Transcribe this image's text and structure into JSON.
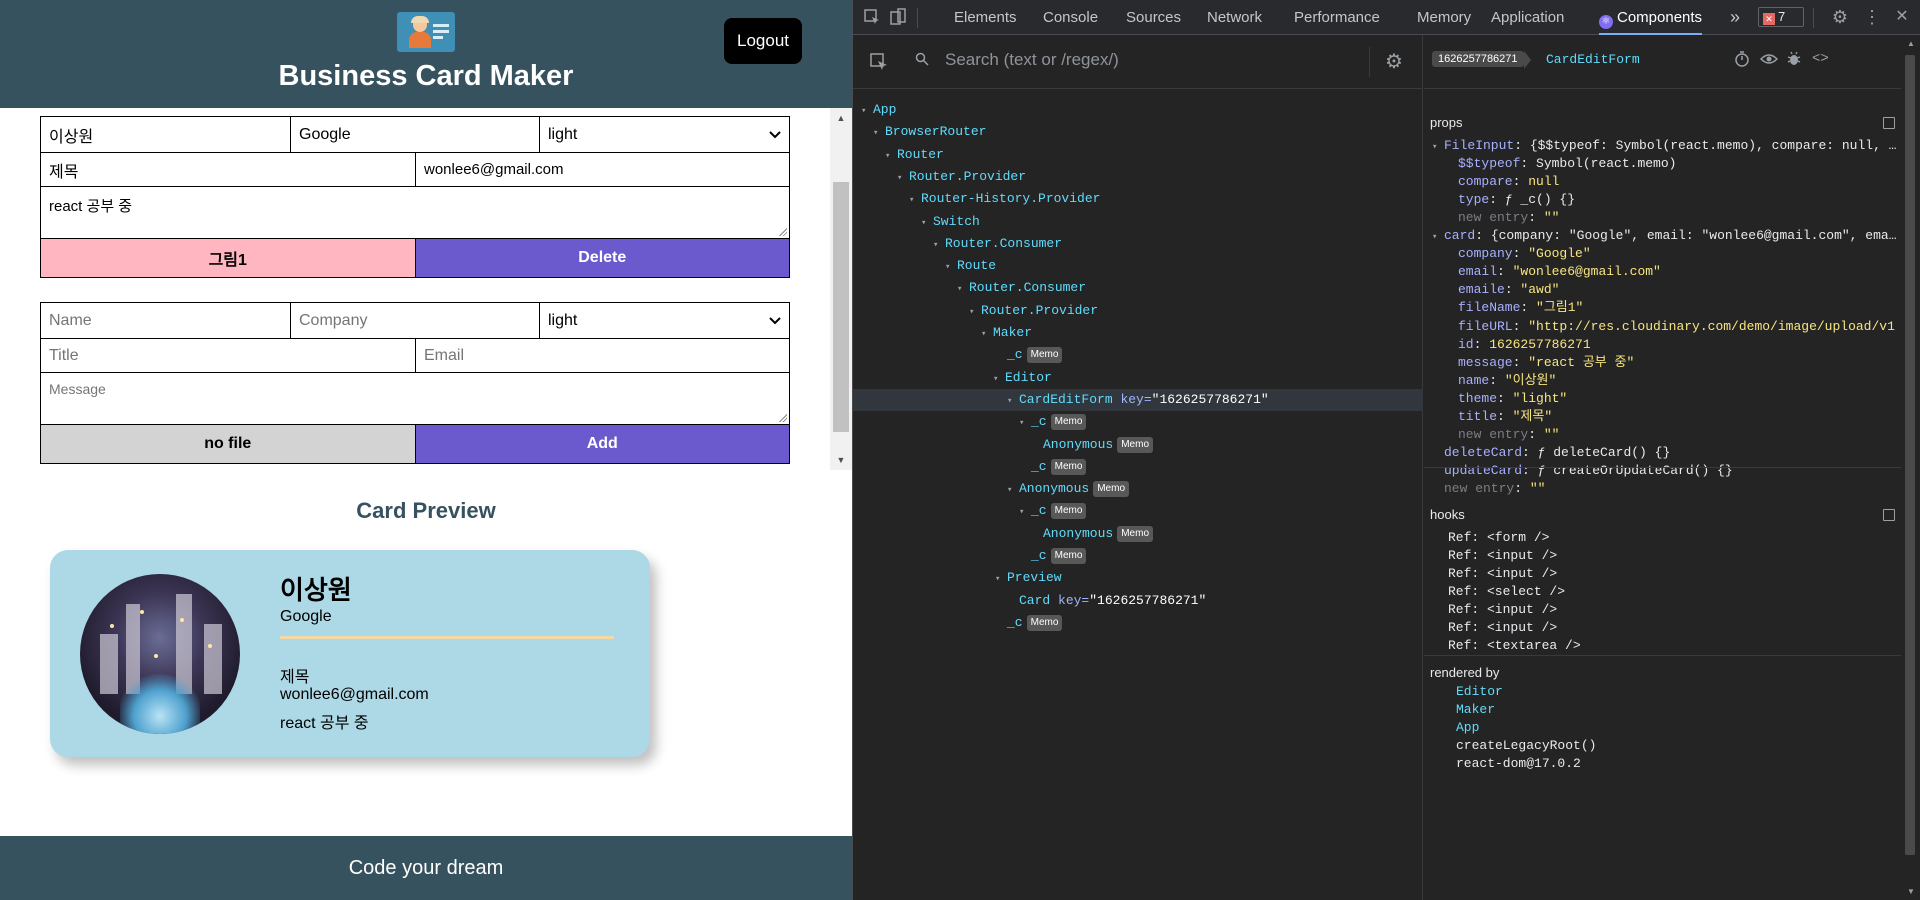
{
  "app": {
    "title": "Business Card Maker",
    "logout_label": "Logout",
    "footer": "Code your dream",
    "preview_title": "Card Preview"
  },
  "edit_form": {
    "name": "이상원",
    "company": "Google",
    "theme": "light",
    "title": "제목",
    "email": "wonlee6@gmail.com",
    "message": "react 공부 중",
    "file_button": "그림1",
    "delete_button": "Delete"
  },
  "add_form": {
    "name_placeholder": "Name",
    "company_placeholder": "Company",
    "theme": "light",
    "title_placeholder": "Title",
    "email_placeholder": "Email",
    "message_placeholder": "Message",
    "file_button": "no file",
    "add_button": "Add"
  },
  "card": {
    "name": "이상원",
    "company": "Google",
    "title": "제목",
    "email": "wonlee6@gmail.com",
    "message": "react 공부 중",
    "background": "#add8e6"
  },
  "devtools": {
    "tabs": [
      "Elements",
      "Console",
      "Sources",
      "Network",
      "Performance",
      "Memory",
      "Application",
      "Components"
    ],
    "active_tab": "Components",
    "more": "»",
    "error_count": "7",
    "search_placeholder": "Search (text or /regex/)",
    "memo_badge": "Memo",
    "tree": [
      {
        "name": "App",
        "tri": "▾"
      },
      {
        "name": "BrowserRouter",
        "tri": "▾"
      },
      {
        "name": "Router",
        "tri": "▾"
      },
      {
        "name": "Router.Provider",
        "tri": "▾"
      },
      {
        "name": "Router-History.Provider",
        "tri": "▾"
      },
      {
        "name": "Switch",
        "tri": "▾"
      },
      {
        "name": "Router.Consumer",
        "tri": "▾"
      },
      {
        "name": "Route",
        "tri": "▾"
      },
      {
        "name": "Router.Consumer",
        "tri": "▾"
      },
      {
        "name": "Router.Provider",
        "tri": "▾"
      },
      {
        "name": "Maker",
        "tri": "▾"
      },
      {
        "name": "_c",
        "tri": ""
      },
      {
        "name": "Editor",
        "tri": "▾"
      },
      {
        "name": "CardEditForm",
        "tri": "▾",
        "key_label": "key=",
        "key_value": "\"1626257786271\""
      },
      {
        "name": "_c",
        "tri": "▾"
      },
      {
        "name": "Anonymous",
        "tri": ""
      },
      {
        "name": "_c",
        "tri": ""
      },
      {
        "name": "Anonymous",
        "tri": "▾"
      },
      {
        "name": "_c",
        "tri": "▾"
      },
      {
        "name": "Anonymous",
        "tri": ""
      },
      {
        "name": "_c",
        "tri": ""
      },
      {
        "name": "Preview",
        "tri": "▾"
      },
      {
        "name": "Card",
        "tri": "",
        "key_label": "key=",
        "key_value": "\"1626257786271\""
      },
      {
        "name": "_c",
        "tri": ""
      }
    ],
    "inspector": {
      "id": "1626257786271",
      "component": "CardEditForm",
      "props_title": "props",
      "props": {
        "file_input_key": "FileInput",
        "file_input_summary": "{$$typeof: Symbol(react.memo), compare: null, …",
        "typeof_key": "$$typeof",
        "typeof_val": "Symbol(react.memo)",
        "compare_key": "compare",
        "compare_val": "null",
        "type_key": "type",
        "type_val": "ƒ _c() {}",
        "new_entry": "new entry",
        "empty_str": "\"\"",
        "card_key": "card",
        "card_summary": "{company: \"Google\", email: \"wonlee6@gmail.com\", ema…",
        "card_fields": [
          {
            "k": "company",
            "v": "\"Google\""
          },
          {
            "k": "email",
            "v": "\"wonlee6@gmail.com\""
          },
          {
            "k": "emaile",
            "v": "\"awd\""
          },
          {
            "k": "fileName",
            "v": "\"그림1\""
          },
          {
            "k": "fileURL",
            "v": "\"http://res.cloudinary.com/demo/image/upload/v1"
          },
          {
            "k": "id",
            "v": "1626257786271"
          },
          {
            "k": "message",
            "v": "\"react 공부 중\""
          },
          {
            "k": "name",
            "v": "\"이상원\""
          },
          {
            "k": "theme",
            "v": "\"light\""
          },
          {
            "k": "title",
            "v": "\"제목\""
          }
        ],
        "delete_key": "deleteCard",
        "delete_val": "ƒ deleteCard() {}",
        "update_key": "updateCard",
        "update_val": "ƒ createOrUpdateCard() {}"
      },
      "hooks_title": "hooks",
      "hooks": [
        "Ref: <form />",
        "Ref: <input />",
        "Ref: <input />",
        "Ref: <select />",
        "Ref: <input />",
        "Ref: <input />",
        "Ref: <textarea />"
      ],
      "rendered_title": "rendered by",
      "rendered_by": [
        "Editor",
        "Maker",
        "App",
        "createLegacyRoot()",
        "react-dom@17.0.2"
      ]
    }
  }
}
